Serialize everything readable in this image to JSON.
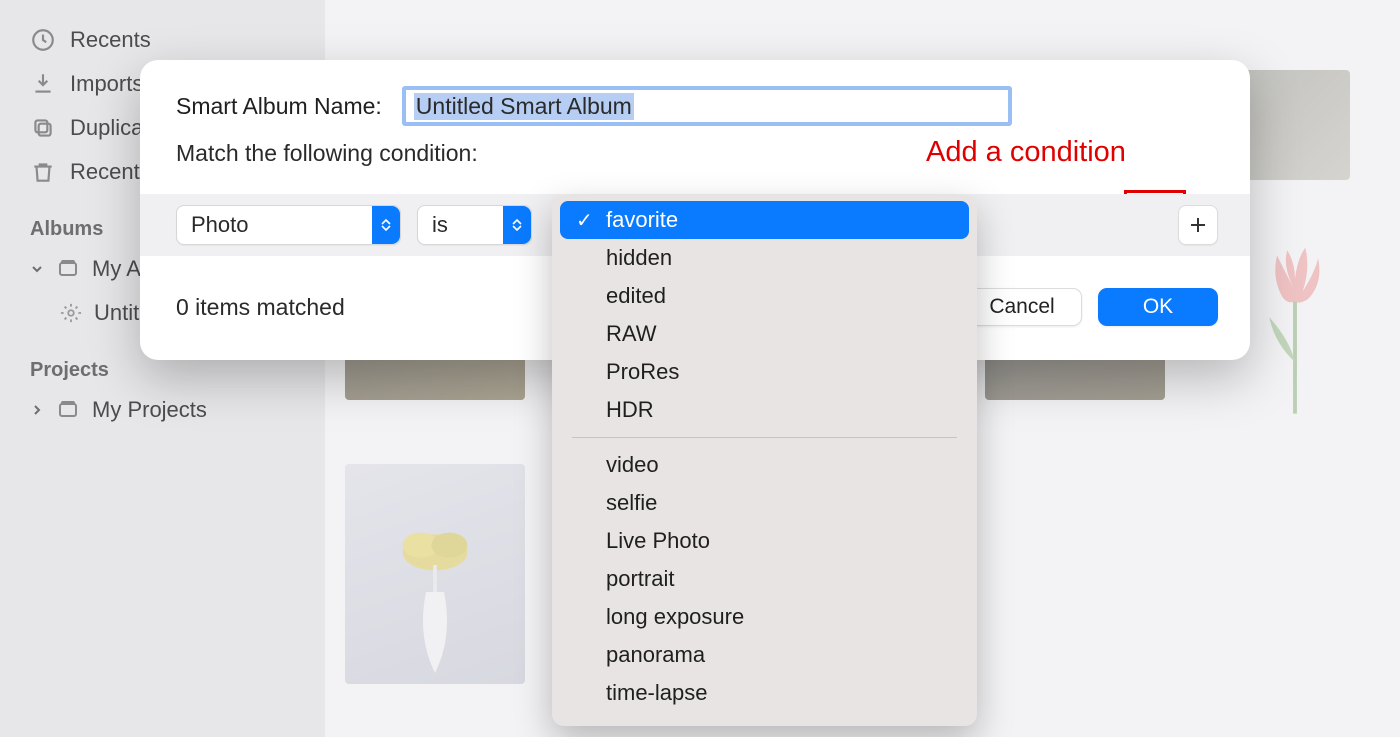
{
  "sidebar": {
    "items": [
      {
        "icon": "clock-icon",
        "label": "Recents"
      },
      {
        "icon": "import-icon",
        "label": "Imports"
      },
      {
        "icon": "duplicate-icon",
        "label": "Duplicates"
      },
      {
        "icon": "trash-icon",
        "label": "Recently Deleted"
      }
    ],
    "sections": {
      "albums": {
        "label": "Albums",
        "my_albums": "My Albums",
        "untitled": "Untitled Smart Album"
      },
      "projects": {
        "label": "Projects",
        "my_projects": "My Projects"
      }
    }
  },
  "sheet": {
    "name_label": "Smart Album Name:",
    "name_value": "Untitled Smart Album",
    "match_label": "Match the following condition:",
    "condition": {
      "field": "Photo",
      "operator": "is"
    },
    "match_count": "0 items matched",
    "cancel": "Cancel",
    "ok": "OK"
  },
  "annotation": {
    "text": "Add a condition"
  },
  "dropdown": {
    "selected": "favorite",
    "group1": [
      "favorite",
      "hidden",
      "edited",
      "RAW",
      "ProRes",
      "HDR"
    ],
    "group2": [
      "video",
      "selfie",
      "Live Photo",
      "portrait",
      "long exposure",
      "panorama",
      "time-lapse"
    ]
  }
}
